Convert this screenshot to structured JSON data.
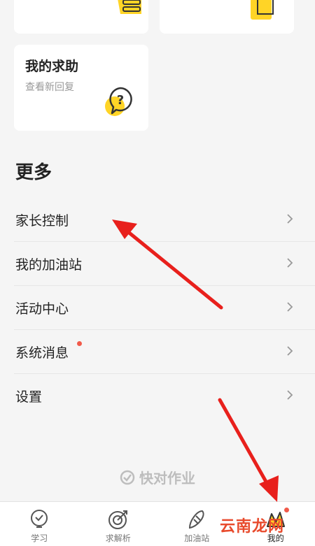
{
  "cards_top": [
    {
      "name": "card-left-partial"
    },
    {
      "name": "card-right-partial"
    }
  ],
  "help_card": {
    "title": "我的求助",
    "subtitle": "查看新回复"
  },
  "section_title": "更多",
  "menu": [
    {
      "label": "家长控制",
      "badge": false
    },
    {
      "label": "我的加油站",
      "badge": false
    },
    {
      "label": "活动中心",
      "badge": false
    },
    {
      "label": "系统消息",
      "badge": true
    },
    {
      "label": "设置",
      "badge": false
    }
  ],
  "brand": "快对作业",
  "tabs": [
    {
      "label": "学习",
      "icon": "lightbulb-icon"
    },
    {
      "label": "求解析",
      "icon": "target-icon"
    },
    {
      "label": "加油站",
      "icon": "carrot-icon"
    },
    {
      "label": "我的",
      "icon": "profile-icon",
      "active": true
    }
  ],
  "watermark": "云南龙网",
  "colors": {
    "accent": "#ffd426",
    "badge": "#f15a4a",
    "arrow": "#e8201c"
  }
}
